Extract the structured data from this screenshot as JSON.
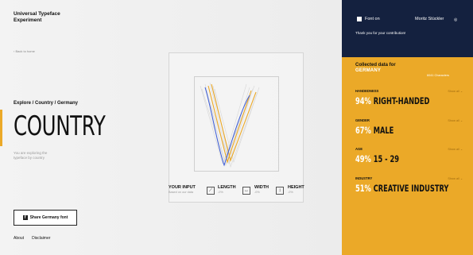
{
  "site": {
    "title": "Universal Typeface Experiment",
    "back_link": "Back to home"
  },
  "explore": {
    "breadcrumb": "Explore / Country / Germany",
    "title": "COUNTRY",
    "description": "You are exploring the typeface by country"
  },
  "share": {
    "label": "Share Germany font",
    "icon": "facebook-icon"
  },
  "footer": {
    "about": "About",
    "disclaimer": "Disclaimer"
  },
  "metrics": {
    "input_label": "YOUR INPUT",
    "input_sub": "Based on our data",
    "length_label": "LENGTH",
    "length_value": "-0%",
    "width_label": "WIDTH",
    "width_value": "-0%",
    "height_label": "HEIGHT",
    "height_value": "-0%"
  },
  "sidebar": {
    "font_on_label": "Font on",
    "user_name": "Moritz Stückler",
    "thanks": "Thank you for your contribution!",
    "collected_label": "Collected data for",
    "country": "GERMANY",
    "characters": "6041 Characters",
    "stats": [
      {
        "label": "HANDEDNESS",
        "percent": "94%",
        "value": "RIGHT-HANDED",
        "show_all": "Show all"
      },
      {
        "label": "GENDER",
        "percent": "67%",
        "value": "MALE",
        "show_all": "Show all"
      },
      {
        "label": "AGE",
        "percent": "49%",
        "value": "15 - 29",
        "show_all": "Show all"
      },
      {
        "label": "INDUSTRY",
        "percent": "51%",
        "value": "CREATIVE INDUSTRY",
        "show_all": "Show all"
      }
    ]
  },
  "colors": {
    "navy": "#14213f",
    "accent": "#eba928",
    "glyph_user": "#3b5bd6",
    "glyph_avg": "#eba928"
  }
}
